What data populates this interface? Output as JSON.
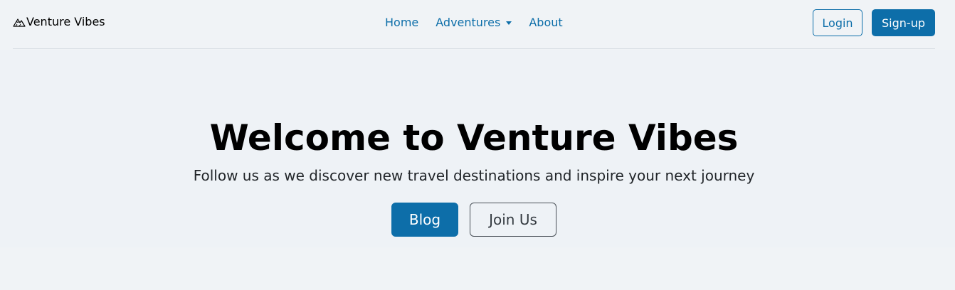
{
  "brand": {
    "name": "Venture Vibes",
    "icon": "mountain-icon"
  },
  "nav": {
    "links": [
      {
        "label": "Home"
      },
      {
        "label": "Adventures",
        "has_dropdown": true
      },
      {
        "label": "About"
      }
    ]
  },
  "auth": {
    "login_label": "Login",
    "signup_label": "Sign-up"
  },
  "hero": {
    "title": "Welcome to Venture Vibes",
    "subtitle": "Follow us as we discover new travel destinations and inspire your next journey",
    "primary_button": "Blog",
    "secondary_button": "Join Us"
  },
  "colors": {
    "accent": "#0d6ea9",
    "background": "#f0f3f6",
    "hero_background": "#eef2f6",
    "text": "#212529"
  }
}
